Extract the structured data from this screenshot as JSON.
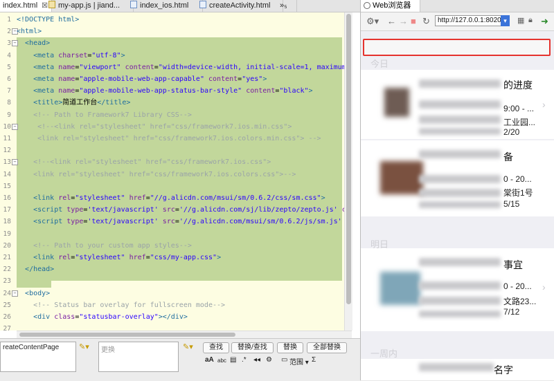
{
  "editor": {
    "tabs": [
      {
        "label": "index.html",
        "type": "html",
        "active": true
      },
      {
        "label": "my-app.js | jiand...",
        "type": "js",
        "active": false
      },
      {
        "label": "index_ios.html",
        "type": "html",
        "active": false
      },
      {
        "label": "createActivity.html",
        "type": "html",
        "active": false
      },
      {
        "label": "»₅",
        "type": "overflow",
        "active": false
      }
    ],
    "lines": [
      {
        "n": "1",
        "html": "<span class=\"t\">&lt;!DOCTYPE html&gt;</span>"
      },
      {
        "n": "2",
        "fold": "−",
        "html": "<span class=\"t\">&lt;html&gt;</span>"
      },
      {
        "n": "3",
        "fold": "−",
        "html": "  <span class=\"t\">&lt;head&gt;</span>"
      },
      {
        "n": "4",
        "html": "    <span class=\"t\">&lt;meta</span> <span class=\"a\">charset</span>=<span class=\"s\">\"utf-8\"</span><span class=\"t\">&gt;</span>"
      },
      {
        "n": "5",
        "html": "    <span class=\"t\">&lt;meta</span> <span class=\"a\">name</span>=<span class=\"s\">\"viewport\"</span> <span class=\"a\">content</span>=<span class=\"s\">\"width=device-width, initial-scale=1, maximum-scal</span>"
      },
      {
        "n": "6",
        "html": "    <span class=\"t\">&lt;meta</span> <span class=\"a\">name</span>=<span class=\"s\">\"apple-mobile-web-app-capable\"</span> <span class=\"a\">content</span>=<span class=\"s\">\"yes\"</span><span class=\"t\">&gt;</span>"
      },
      {
        "n": "7",
        "html": "    <span class=\"t\">&lt;meta</span> <span class=\"a\">name</span>=<span class=\"s\">\"apple-mobile-web-app-status-bar-style\"</span> <span class=\"a\">content</span>=<span class=\"s\">\"black\"</span><span class=\"t\">&gt;</span>"
      },
      {
        "n": "8",
        "html": "    <span class=\"t\">&lt;title&gt;</span>简道工作台<span class=\"t\">&lt;/title&gt;</span>"
      },
      {
        "n": "9",
        "html": "    <span class=\"c\">&lt;!-- Path to Framework7 Library CSS--&gt;</span>"
      },
      {
        "n": "10",
        "fold": "−",
        "html": "     <span class=\"c\">&lt;!--&lt;link rel=\"stylesheet\" href=\"css/framework7.ios.min.css\"&gt;</span>"
      },
      {
        "n": "11",
        "html": "     <span class=\"c\">&lt;link rel=\"stylesheet\" href=\"css/framework7.ios.colors.min.css\"&gt; --&gt;</span>"
      },
      {
        "n": "12",
        "html": ""
      },
      {
        "n": "13",
        "fold": "−",
        "html": "    <span class=\"c\">&lt;!--&lt;link rel=\"stylesheet\" href=\"css/framework7.ios.css\"&gt;</span>"
      },
      {
        "n": "14",
        "html": "    <span class=\"c\">&lt;link rel=\"stylesheet\" href=\"css/framework7.ios.colors.css\"&gt;--&gt;</span>"
      },
      {
        "n": "15",
        "html": ""
      },
      {
        "n": "16",
        "html": "    <span class=\"t\">&lt;link</span> <span class=\"a\">rel</span>=<span class=\"s\">\"stylesheet\"</span> <span class=\"a\">href</span>=<span class=\"s\">\"//g.alicdn.com/msui/sm/0.6.2/css/sm.css\"</span><span class=\"t\">&gt;</span>"
      },
      {
        "n": "17",
        "html": "    <span class=\"t\">&lt;script</span> <span class=\"a\">type</span>=<span class=\"s\">'text/javascript'</span> <span class=\"a\">src</span>=<span class=\"s\">'//g.alicdn.com/sj/lib/zepto/zepto.js'</span> <span class=\"a\">charse</span>"
      },
      {
        "n": "18",
        "html": "    <span class=\"t\">&lt;script</span> <span class=\"a\">type</span>=<span class=\"s\">'text/javascript'</span> <span class=\"a\">src</span>=<span class=\"s\">'//g.alicdn.com/msui/sm/0.6.2/js/sm.js'</span> <span class=\"a\">chars</span>"
      },
      {
        "n": "19",
        "html": ""
      },
      {
        "n": "20",
        "html": "    <span class=\"c\">&lt;!-- Path to your custom app styles--&gt;</span>"
      },
      {
        "n": "21",
        "html": "    <span class=\"t\">&lt;link</span> <span class=\"a\">rel</span>=<span class=\"s\">\"stylesheet\"</span> <span class=\"a\">href</span>=<span class=\"s\">\"css/my-app.css\"</span><span class=\"t\">&gt;</span>"
      },
      {
        "n": "22",
        "html": "  <span class=\"t\">&lt;/head&gt;</span>"
      },
      {
        "n": "23",
        "html": ""
      },
      {
        "n": "24",
        "fold": "−",
        "html": "  <span class=\"t\">&lt;body&gt;</span>"
      },
      {
        "n": "25",
        "html": "    <span class=\"c\">&lt;!-- Status bar overlay for fullscreen mode--&gt;</span>"
      },
      {
        "n": "26",
        "html": "    <span class=\"t\">&lt;div</span> <span class=\"a\">class</span>=<span class=\"s\">\"statusbar-overlay\"</span><span class=\"t\">&gt;&lt;/div&gt;</span>"
      },
      {
        "n": "27",
        "html": ""
      }
    ]
  },
  "find_bar": {
    "find_value": "reateContentPage",
    "replace_placeholder": "更换",
    "buttons": [
      "查找",
      "替换/查找",
      "替换",
      "全部替换"
    ],
    "options_label": "范围 ▾",
    "sigma": "Σ"
  },
  "browser": {
    "tab_label": "Web浏览器",
    "url": "http://127.0.0.1:8020/",
    "sections": [
      "今日",
      "明日",
      "一周内"
    ],
    "cards": [
      {
        "title": "的进度",
        "time": "9:00 - ...",
        "place": "工业园...",
        "date": "2/20"
      },
      {
        "title": "备",
        "time": "0 - 20...",
        "place": "棠街1号",
        "date": "5/15"
      },
      {
        "title": "事宜",
        "time": "0 - 20...",
        "place": "文路23...",
        "date": "7/12"
      }
    ],
    "last_title": "名字"
  },
  "colors": {
    "accent_red": "#e5322d",
    "highlight": "#c2d79b",
    "editor_bg": "#fdfde2"
  }
}
